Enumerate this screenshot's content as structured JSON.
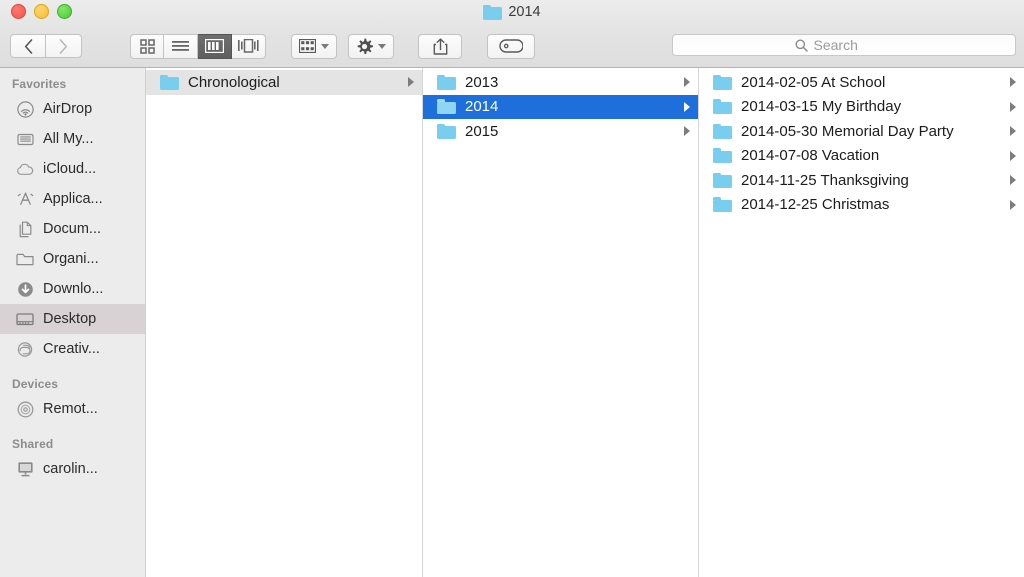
{
  "window": {
    "title": "2014",
    "title_icon": "folder-icon",
    "traffic_lights": [
      {
        "name": "close-button",
        "color": "#f0544c"
      },
      {
        "name": "minimize-button",
        "color": "#f5bd30"
      },
      {
        "name": "maximize-button",
        "color": "#48c932"
      }
    ]
  },
  "toolbar": {
    "back_label": "‹",
    "forward_label": "›",
    "view_buttons": [
      {
        "name": "icon-view-button",
        "icon": "grid-icon",
        "active": false
      },
      {
        "name": "list-view-button",
        "icon": "list-icon",
        "active": false
      },
      {
        "name": "column-view-button",
        "icon": "columns-icon",
        "active": true
      },
      {
        "name": "coverflow-view-button",
        "icon": "coverflow-icon",
        "active": false
      }
    ],
    "arrange_button": {
      "name": "arrange-button",
      "icon": "arrange-grid-icon"
    },
    "action_button": {
      "name": "action-gear-button",
      "icon": "gear-icon"
    },
    "share_button": {
      "name": "share-button",
      "icon": "share-icon"
    },
    "tags_button": {
      "name": "tags-button",
      "icon": "tag-icon"
    }
  },
  "search": {
    "placeholder": "Search",
    "value": "",
    "icon": "search-icon"
  },
  "sidebar": {
    "sections": [
      {
        "header": "Favorites",
        "items": [
          {
            "label": "AirDrop",
            "icon": "airdrop-icon",
            "selected": false
          },
          {
            "label": "All My...",
            "icon": "all-my-files-icon",
            "selected": false
          },
          {
            "label": "iCloud...",
            "icon": "icloud-icon",
            "selected": false
          },
          {
            "label": "Applica...",
            "icon": "applications-icon",
            "selected": false
          },
          {
            "label": "Docum...",
            "icon": "documents-icon",
            "selected": false
          },
          {
            "label": "Organi...",
            "icon": "folder-icon",
            "selected": false
          },
          {
            "label": "Downlo...",
            "icon": "downloads-icon",
            "selected": false
          },
          {
            "label": "Desktop",
            "icon": "desktop-icon",
            "selected": true
          },
          {
            "label": "Creativ...",
            "icon": "creative-cloud-icon",
            "selected": false
          }
        ]
      },
      {
        "header": "Devices",
        "items": [
          {
            "label": "Remot...",
            "icon": "remote-disc-icon",
            "selected": false
          }
        ]
      },
      {
        "header": "Shared",
        "items": [
          {
            "label": "carolin...",
            "icon": "shared-computer-icon",
            "selected": false
          }
        ]
      }
    ]
  },
  "columns": [
    {
      "name": "column-1",
      "rows": [
        {
          "label": "Chronological",
          "icon": "folder-icon",
          "has_chevron": true,
          "state": "inactive"
        }
      ]
    },
    {
      "name": "column-2",
      "rows": [
        {
          "label": "2013",
          "icon": "folder-icon",
          "has_chevron": true,
          "state": "none"
        },
        {
          "label": "2014",
          "icon": "folder-icon",
          "has_chevron": true,
          "state": "active"
        },
        {
          "label": "2015",
          "icon": "folder-icon",
          "has_chevron": true,
          "state": "none"
        }
      ]
    },
    {
      "name": "column-3",
      "rows": [
        {
          "label": "2014-02-05 At School",
          "icon": "folder-icon",
          "has_chevron": true,
          "state": "none"
        },
        {
          "label": "2014-03-15 My Birthday",
          "icon": "folder-icon",
          "has_chevron": true,
          "state": "none"
        },
        {
          "label": "2014-05-30 Memorial Day Party",
          "icon": "folder-icon",
          "has_chevron": true,
          "state": "none"
        },
        {
          "label": "2014-07-08 Vacation",
          "icon": "folder-icon",
          "has_chevron": true,
          "state": "none"
        },
        {
          "label": "2014-11-25 Thanksgiving",
          "icon": "folder-icon",
          "has_chevron": true,
          "state": "none"
        },
        {
          "label": "2014-12-25 Christmas",
          "icon": "folder-icon",
          "has_chevron": true,
          "state": "none"
        }
      ]
    }
  ],
  "colors": {
    "selection_blue": "#1e6fdb",
    "folder_blue": "#79cdef",
    "sidebar_bg": "#ececec",
    "toolbar_bg": "#e3e3e3"
  }
}
